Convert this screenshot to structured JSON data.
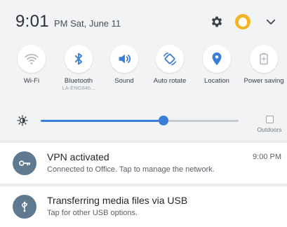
{
  "header": {
    "time": "9:01",
    "ampm_date": "PM Sat, June 11",
    "icons": [
      "gear-icon",
      "avatar-icon",
      "chevron-down-icon"
    ]
  },
  "tiles": [
    {
      "label": "Wi-Fi",
      "sub": "",
      "icon": "wifi-icon",
      "active": false
    },
    {
      "label": "Bluetooth",
      "sub": "LA-ENG846...",
      "icon": "bluetooth-icon",
      "active": true
    },
    {
      "label": "Sound",
      "sub": "",
      "icon": "sound-icon",
      "active": true
    },
    {
      "label": "Auto rotate",
      "sub": "",
      "icon": "auto-rotate-icon",
      "active": true
    },
    {
      "label": "Location",
      "sub": "",
      "icon": "location-icon",
      "active": true
    },
    {
      "label": "Power saving",
      "sub": "",
      "icon": "power-saving-icon",
      "active": false
    }
  ],
  "brightness": {
    "level": 0.62,
    "outdoors_label": "Outdoors",
    "outdoors_checked": false
  },
  "notifications": [
    {
      "title": "VPN activated",
      "text": "Connected to Office. Tap to manage the network.",
      "time": "9:00 PM",
      "icon": "vpn-key-icon"
    },
    {
      "title": "Transferring media files via USB",
      "text": "Tap for other USB options.",
      "icon": "usb-icon"
    }
  ],
  "colors": {
    "accent": "#3a7dd8",
    "inactive": "#b8bdc3",
    "avatar": "#f4b322",
    "notif_icon_bg": "#5f7a90"
  }
}
